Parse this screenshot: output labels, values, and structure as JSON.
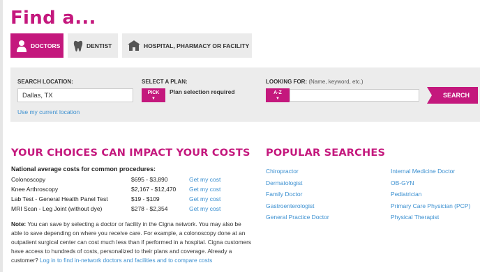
{
  "heading": "Find a...",
  "tabs": [
    {
      "label": "DOCTORS",
      "icon": "doctor-icon",
      "active": true
    },
    {
      "label": "DENTIST",
      "icon": "tooth-icon",
      "active": false
    },
    {
      "label": "HOSPITAL, PHARMACY OR FACILITY",
      "icon": "hospital-icon",
      "active": false
    }
  ],
  "search": {
    "location_label": "SEARCH LOCATION:",
    "location_value": "Dallas, TX",
    "current_location_link": "Use my current location",
    "plan_label": "SELECT A PLAN:",
    "plan_button": "PICK",
    "plan_status": "Plan selection required",
    "looking_label": "LOOKING FOR:",
    "looking_hint": "(Name, keyword, etc.)",
    "az_button": "A-Z",
    "looking_value": "",
    "search_button": "SEARCH"
  },
  "costs": {
    "title": "YOUR CHOICES CAN IMPACT YOUR COSTS",
    "subtitle": "National average costs for common procedures:",
    "rows": [
      {
        "procedure": "Colonoscopy",
        "range": "$695 - $3,890",
        "link": "Get my cost"
      },
      {
        "procedure": "Knee Arthroscopy",
        "range": "$2,167 - $12,470",
        "link": "Get my cost"
      },
      {
        "procedure": "Lab Test - General Health Panel Test",
        "range": "$19 - $109",
        "link": "Get my cost"
      },
      {
        "procedure": "MRI Scan - Leg Joint (without dye)",
        "range": "$278 - $2,354",
        "link": "Get my cost"
      }
    ],
    "note_label": "Note:",
    "note_text": " You can save by selecting a doctor or facility in the Cigna network. You may also be able to save depending on where you receive care. For example, a colonoscopy done at an outpatient surgical center can cost much less than if performed in a hospital. Cigna customers have access to hundreds of costs, personalized to their plans and coverage. Already a customer? ",
    "note_link": "Log in to find in-network doctors and facilities and to compare costs"
  },
  "popular": {
    "title": "POPULAR SEARCHES",
    "left": [
      "Chiropractor",
      "Dermatologist",
      "Family Doctor",
      "Gastroenterologist",
      "General Practice Doctor"
    ],
    "right": [
      "Internal Medicine Doctor",
      "OB-GYN",
      "Pediatrician",
      "Primary Care Physician (PCP)",
      "Physical Therapist"
    ]
  },
  "colors": {
    "accent": "#c4187d",
    "link": "#3a8fd0",
    "panel": "#ececec"
  }
}
